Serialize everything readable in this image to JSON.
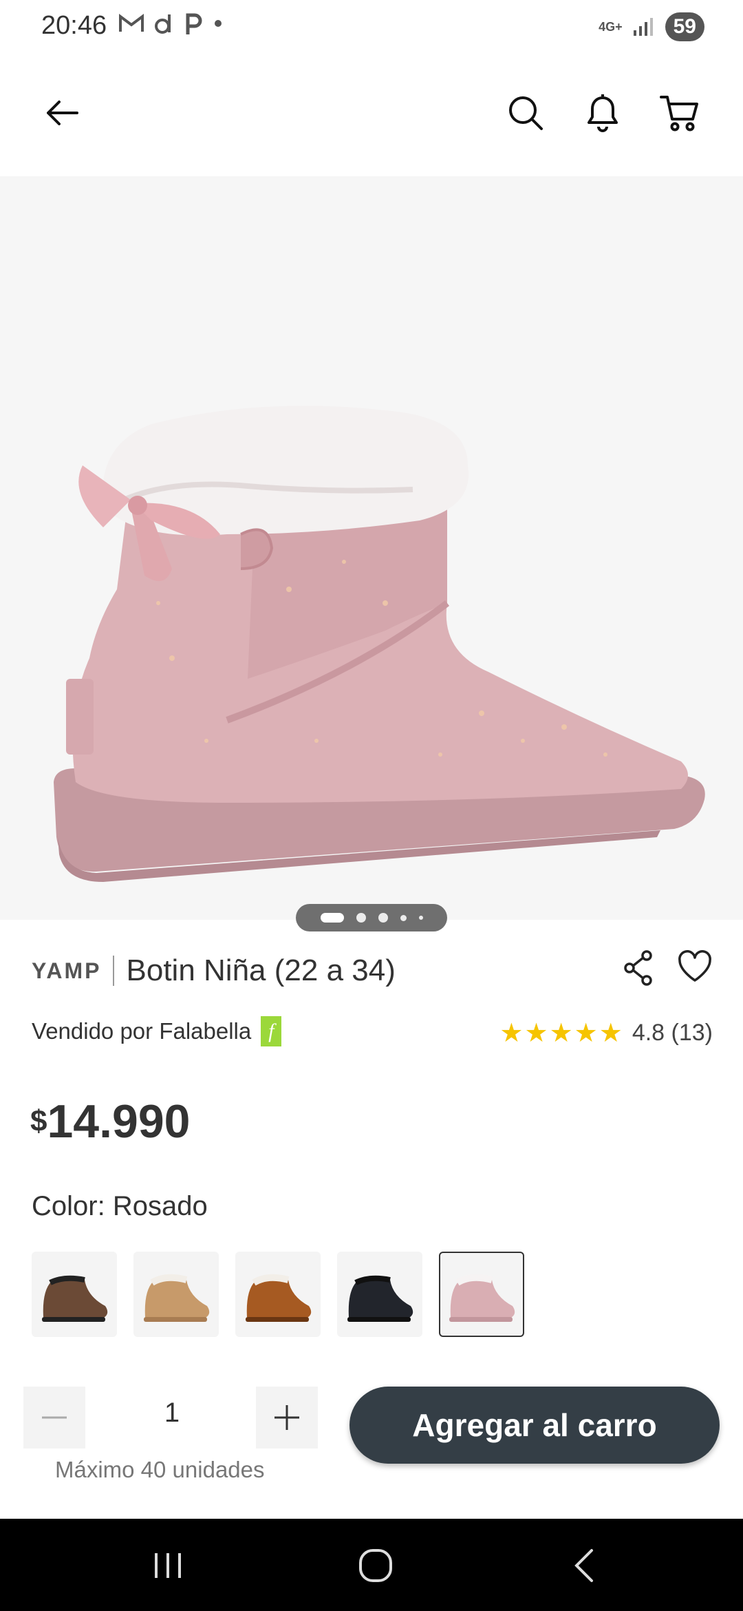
{
  "status_bar": {
    "time": "20:46",
    "network": "4G+",
    "battery": "59"
  },
  "nav": {
    "back_icon": "arrow-left-icon",
    "search_icon": "search-icon",
    "bell_icon": "bell-icon",
    "cart_icon": "cart-icon"
  },
  "product": {
    "brand": "YAMP",
    "name": "Botin Niña (22 a 34)",
    "seller": "Vendido por Falabella",
    "seller_logo": "f",
    "rating": "4.8",
    "rating_count": "(13)",
    "stars": 5,
    "price_currency": "$",
    "price_amount": "14.990",
    "color_label": "Color: Rosado",
    "image_pages": 5,
    "current_image": 1
  },
  "swatches": [
    {
      "name": "leopard",
      "color": "#6b4a36",
      "selected": false
    },
    {
      "name": "camel",
      "color": "#c79a6a",
      "selected": false
    },
    {
      "name": "chestnut",
      "color": "#a65a22",
      "selected": false
    },
    {
      "name": "black",
      "color": "#22252c",
      "selected": false
    },
    {
      "name": "pink",
      "color": "#d9aeb3",
      "selected": true
    }
  ],
  "cart": {
    "quantity": "1",
    "max_units": "Máximo 40 unidades",
    "add_button": "Agregar al carro"
  },
  "colors": {
    "button": "#343e46",
    "star": "#f6c400",
    "falabella_green": "#9bd83a"
  }
}
